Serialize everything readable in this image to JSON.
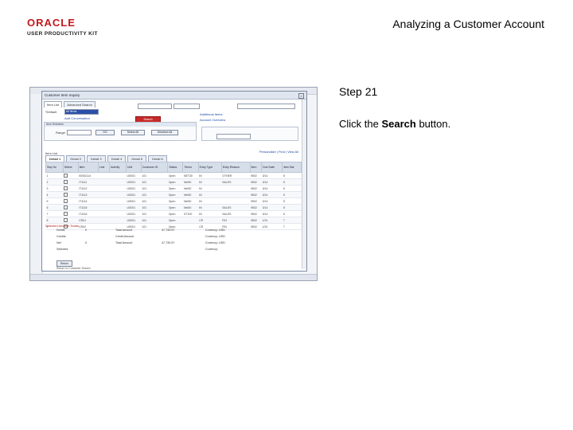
{
  "header": {
    "logo_word": "ORACLE",
    "logo_sub": "USER PRODUCTIVITY KIT",
    "slide_title": "Analyzing a Customer Account"
  },
  "instructions": {
    "step": "Step 21",
    "prefix": "Click the ",
    "bold": "Search",
    "suffix": " button."
  },
  "screenshot": {
    "dialog_title": "Customer Item Inquiry",
    "subtabs": [
      "Item List",
      "Advanced Search"
    ],
    "fields": {
      "default_label": "*Default",
      "default_value": "All Items",
      "search_label": "Search",
      "add_conversation": "Add Conversation",
      "account_overview": "Account Overview",
      "more_about": "Additional Items"
    },
    "group_box_label": "Item Selection",
    "range_label": "Range",
    "buttons": [
      "GO",
      "Select All",
      "Deselect All"
    ],
    "grid": {
      "title": "Item List",
      "links": "Personalize | Find | View All",
      "tabs": [
        "Detail 1",
        "Detail 2",
        "Detail 3",
        "Detail 4",
        "Detail 5",
        "Detail 6"
      ],
      "columns": [
        "Seq No",
        "Select",
        "Item",
        "Line",
        "Activity",
        "Unit",
        "Customer ID",
        "Status",
        "Terms",
        "Entry Type",
        "Entry Reason",
        "Item",
        "Due Date",
        "Item Bal"
      ],
      "rows": [
        [
          "1",
          "",
          "00001114",
          "",
          "",
          "US001",
          "101",
          "Open",
          "NET30",
          "IN",
          "OTHER",
          "9502",
          "3/14",
          "5"
        ],
        [
          "2",
          "",
          "IT1111",
          "",
          "",
          "US001",
          "101",
          "Open",
          "Net30",
          "IN",
          "SALES",
          "9502",
          "3/14",
          "5"
        ],
        [
          "3",
          "",
          "IT1112",
          "",
          "",
          "US001",
          "101",
          "Open",
          "Net30",
          "IN",
          "",
          "9502",
          "3/14",
          "5"
        ],
        [
          "4",
          "",
          "IT1113",
          "",
          "",
          "US001",
          "101",
          "Open",
          "Net30",
          "IN",
          "",
          "9502",
          "3/14",
          "5"
        ],
        [
          "5",
          "",
          "IT1114",
          "",
          "",
          "US001",
          "101",
          "Open",
          "Net30",
          "IN",
          "",
          "9502",
          "3/14",
          "5"
        ],
        [
          "6",
          "",
          "IT1115",
          "",
          "",
          "US001",
          "101",
          "Open",
          "Net30",
          "IN",
          "SALES",
          "9502",
          "3/14",
          "5"
        ],
        [
          "7",
          "",
          "IT1116",
          "",
          "",
          "US001",
          "101",
          "Open",
          "ST100",
          "IN",
          "SALES",
          "9502",
          "3/14",
          "5"
        ],
        [
          "8",
          "",
          "CR01",
          "",
          "",
          "US001",
          "101",
          "Open",
          "",
          "CR",
          "FIN",
          "9502",
          "1/31",
          "7"
        ],
        [
          "9",
          "",
          "CR02",
          "",
          "",
          "US001",
          "101",
          "Open",
          "",
          "CR",
          "FIN",
          "9502",
          "1/31",
          "7"
        ]
      ]
    },
    "summary": {
      "header": "Selected Amount Totals",
      "rows": [
        [
          "Debits",
          "0",
          "Total Amount",
          "47,730.57",
          "Currency: USD"
        ],
        [
          "Credits",
          "",
          "Credit Amount",
          "",
          "Currency: USD"
        ],
        [
          "Net",
          "0",
          "Total Amount",
          "47,730.57",
          "Currency: USD"
        ],
        [
          "Selected",
          "",
          "",
          "",
          "Currency:"
        ]
      ]
    },
    "return_button": "Return",
    "footer_link": "Return to Customer Search",
    "accent_color": "#c92a2a"
  }
}
